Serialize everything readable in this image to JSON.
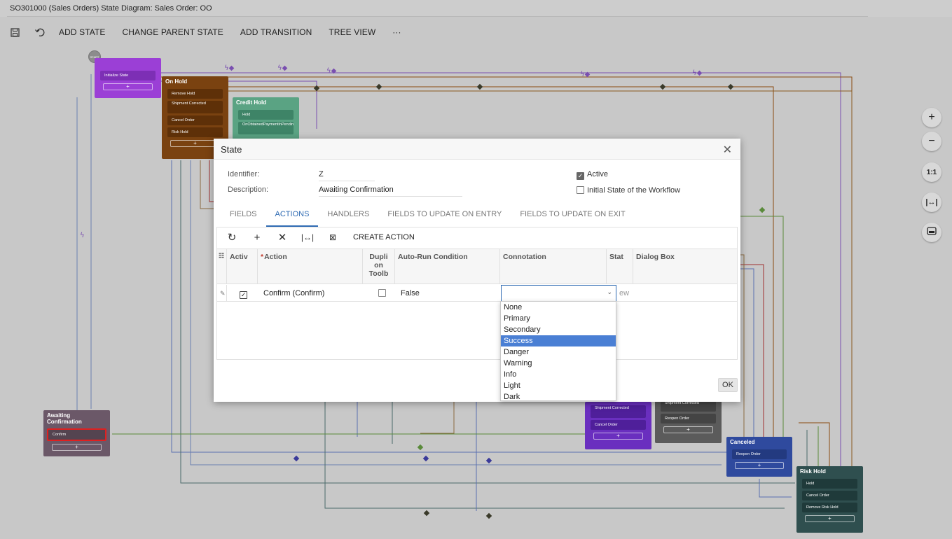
{
  "window": {
    "title": "SO301000 (Sales Orders) State Diagram: Sales Order: OO"
  },
  "toolbar": {
    "save_icon": "save-icon",
    "undo_icon": "undo-icon",
    "add_state": "ADD STATE",
    "change_parent_state": "CHANGE PARENT STATE",
    "add_transition": "ADD TRANSITION",
    "tree_view": "TREE VIEW",
    "more": "···"
  },
  "diagram": {
    "start_label": "START",
    "nodes": {
      "initialize": {
        "title": "",
        "rows": [
          "Initialize State"
        ]
      },
      "on_hold": {
        "title": "On Hold",
        "rows": [
          "Remove Hold",
          "Shipment Corrected",
          "Cancel Order",
          "Risk Hold"
        ]
      },
      "credit_hold": {
        "title": "Credit Hold",
        "rows": [
          "Hold",
          "OnObtainedPaymentInPendingProcessing"
        ]
      },
      "awaiting": {
        "title": "Awaiting Confirmation",
        "rows": [
          "Confirm"
        ]
      },
      "shipment_node": {
        "title": "",
        "rows": [
          "Shipment Corrected",
          "Cancel Order"
        ]
      },
      "grey_node": {
        "title": "",
        "rows": [
          "Shipment Corrected",
          "Reopen Order"
        ]
      },
      "canceled": {
        "title": "Canceled",
        "rows": [
          "Reopen Order"
        ]
      },
      "risk_hold": {
        "title": "Risk Hold",
        "rows": [
          "Hold",
          "Cancel Order",
          "Remove Risk Hold"
        ]
      }
    },
    "plus": "+"
  },
  "zoom": {
    "in": "+",
    "out": "−",
    "one_to_one": "1:1",
    "fit": "|↔|",
    "mini": "minimap-icon"
  },
  "dialog": {
    "title": "State",
    "close": "✕",
    "identifier_label": "Identifier:",
    "identifier_value": "Z",
    "description_label": "Description:",
    "description_value": "Awaiting Confirmation",
    "active_label": "Active",
    "initial_label": "Initial State of the Workflow",
    "tabs": [
      "FIELDS",
      "ACTIONS",
      "HANDLERS",
      "FIELDS TO UPDATE ON ENTRY",
      "FIELDS TO UPDATE ON EXIT"
    ],
    "grid_toolbar": {
      "create_action": "CREATE ACTION"
    },
    "columns": {
      "active": "Activ",
      "action": "Action",
      "duplicate": "Dupli on Toolb",
      "autorun": "Auto-Run Condition",
      "connotation": "Connotation",
      "status": "Stat",
      "dialog_box": "Dialog Box"
    },
    "row": {
      "action": "Confirm (Confirm)",
      "autorun": "False",
      "status_tail": "ew"
    },
    "ok": "OK"
  },
  "dropdown": {
    "options": [
      "None",
      "Primary",
      "Secondary",
      "Success",
      "Danger",
      "Warning",
      "Info",
      "Light",
      "Dark"
    ],
    "highlighted": "Success"
  }
}
